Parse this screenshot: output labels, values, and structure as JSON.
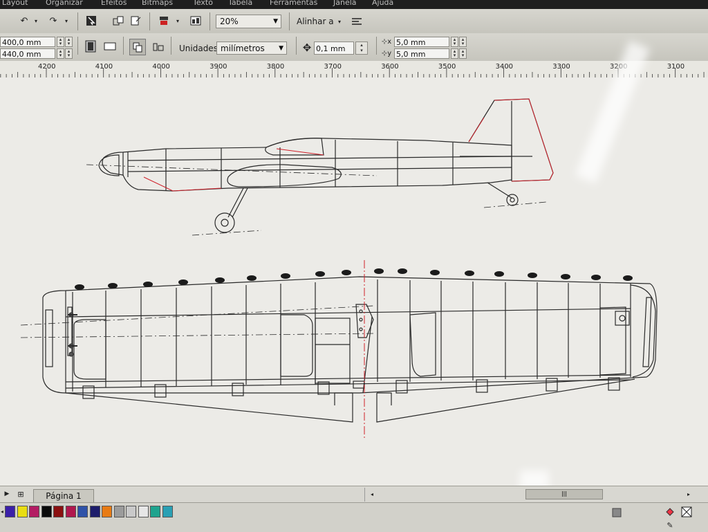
{
  "menu": {
    "items": [
      "Layout",
      "Organizar",
      "Efeitos",
      "Bitmaps",
      "Texto",
      "Tabela",
      "Ferramentas",
      "Janela",
      "Ajuda"
    ]
  },
  "toolbar": {
    "zoom": "20%",
    "align_label": "Alinhar a"
  },
  "property_bar": {
    "width": "400,0 mm",
    "height": "440,0 mm",
    "units_label": "Unidades:",
    "units_value": "milímetros",
    "nudge": "0,1 mm",
    "duplicate_x": "5,0 mm",
    "duplicate_y": "5,0 mm"
  },
  "ruler": {
    "labels": [
      "4200",
      "4100",
      "4000",
      "3900",
      "3800",
      "3700",
      "3600",
      "3500",
      "3400",
      "3300",
      "3200",
      "3100"
    ]
  },
  "page_nav": {
    "page_tab": "Página 1"
  },
  "palette": {
    "colors": [
      "#3a1fa8",
      "#e9dd12",
      "#b31c63",
      "#0a0a0a",
      "#8a1010",
      "#b0184e",
      "#2f52a8",
      "#1d1d6b",
      "#e87b14",
      "#9b9b9b",
      "#c9c9c9",
      "#e6e6e6",
      "#1ea38e",
      "#2aa0b4"
    ]
  },
  "drawing": {
    "line_color": "#2a2a2a",
    "accent_color": "#d0202a"
  }
}
